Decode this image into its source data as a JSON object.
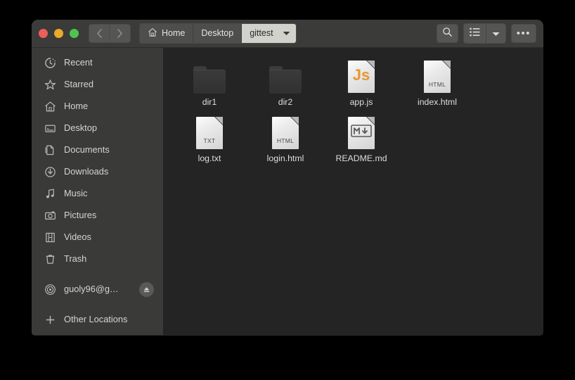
{
  "window": {
    "titlebar": {
      "traffic_lights": [
        {
          "name": "close",
          "color": "#ed5f5a"
        },
        {
          "name": "minimize",
          "color": "#e9ab28"
        },
        {
          "name": "maximize",
          "color": "#4fc34f"
        }
      ],
      "back_label": "Back",
      "forward_label": "Forward",
      "breadcrumbs": [
        {
          "label": "Home",
          "icon": "home-icon",
          "current": false
        },
        {
          "label": "Desktop",
          "icon": "",
          "current": false
        },
        {
          "label": "gittest",
          "icon": "",
          "current": true
        }
      ],
      "search_label": "Search",
      "view_list_label": "List view",
      "view_dropdown_label": "View options",
      "menu_label": "Main menu",
      "menu_glyph": "•••"
    }
  },
  "sidebar": {
    "items": [
      {
        "label": "Recent",
        "icon": "recent-clock-icon"
      },
      {
        "label": "Starred",
        "icon": "star-icon"
      },
      {
        "label": "Home",
        "icon": "home-icon"
      },
      {
        "label": "Desktop",
        "icon": "desktop-icon"
      },
      {
        "label": "Documents",
        "icon": "documents-icon"
      },
      {
        "label": "Downloads",
        "icon": "download-icon"
      },
      {
        "label": "Music",
        "icon": "music-note-icon"
      },
      {
        "label": "Pictures",
        "icon": "camera-icon"
      },
      {
        "label": "Videos",
        "icon": "film-icon"
      },
      {
        "label": "Trash",
        "icon": "trash-icon"
      }
    ],
    "network": {
      "label": "guoly96@g…",
      "icon": "network-icon",
      "eject_label": "Eject"
    },
    "other_locations": {
      "label": "Other Locations",
      "icon": "plus-icon"
    }
  },
  "files": [
    {
      "name": "dir1",
      "type": "folder",
      "tag": ""
    },
    {
      "name": "dir2",
      "type": "folder",
      "tag": ""
    },
    {
      "name": "app.js",
      "type": "js",
      "tag": "Js"
    },
    {
      "name": "index.html",
      "type": "doc",
      "tag": "HTML"
    },
    {
      "name": "log.txt",
      "type": "doc",
      "tag": "TXT"
    },
    {
      "name": "login.html",
      "type": "doc",
      "tag": "HTML"
    },
    {
      "name": "README.md",
      "type": "md",
      "tag": "M"
    }
  ]
}
